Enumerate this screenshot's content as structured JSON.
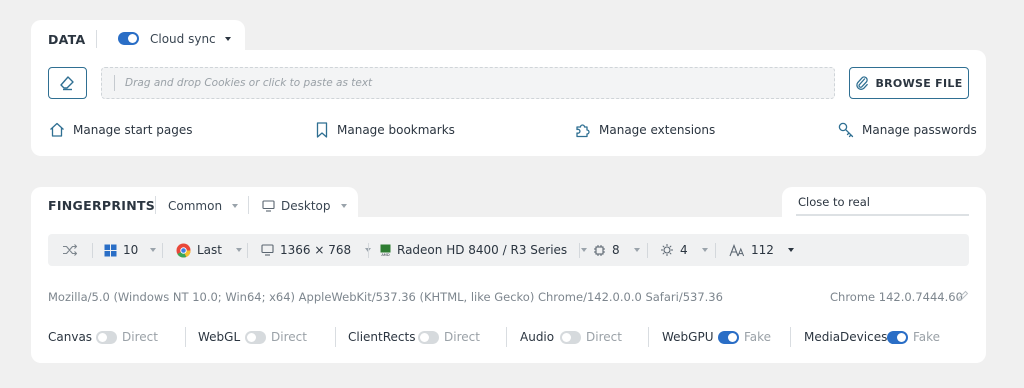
{
  "data_section": {
    "title": "DATA",
    "cloud_sync": {
      "label": "Cloud sync",
      "enabled": true
    },
    "cookies_placeholder": "Drag and drop Cookies or click to paste as text",
    "browse_label": "BROWSE FILE",
    "links": [
      {
        "label": "Manage start pages",
        "icon": "home-icon"
      },
      {
        "label": "Manage bookmarks",
        "icon": "bookmark-icon"
      },
      {
        "label": "Manage extensions",
        "icon": "puzzle-icon"
      },
      {
        "label": "Manage passwords",
        "icon": "key-icon"
      }
    ]
  },
  "fingerprints": {
    "title": "FINGERPRINTS",
    "preset": "Common",
    "device": "Desktop",
    "close_to_real": "Close to real",
    "params": {
      "os": "10",
      "browser": "Last",
      "resolution": "1366 × 768",
      "gpu": "Radeon HD 8400 / R3 Series",
      "cpu": "8",
      "memory": "4",
      "fonts": "112"
    },
    "user_agent": "Mozilla/5.0 (Windows NT 10.0; Win64; x64) AppleWebKit/537.36 (KHTML, like Gecko) Chrome/142.0.0.0 Safari/537.36",
    "chrome_version": "Chrome 142.0.7444.60",
    "protections": [
      {
        "name": "Canvas",
        "mode": "Direct",
        "enabled": false
      },
      {
        "name": "WebGL",
        "mode": "Direct",
        "enabled": false
      },
      {
        "name": "ClientRects",
        "mode": "Direct",
        "enabled": false
      },
      {
        "name": "Audio",
        "mode": "Direct",
        "enabled": false
      },
      {
        "name": "WebGPU",
        "mode": "Fake",
        "enabled": true
      },
      {
        "name": "MediaDevices",
        "mode": "Fake",
        "enabled": true
      }
    ]
  },
  "colors": {
    "accent": "#2a6ec6",
    "border_accent": "#2f6f92",
    "background": "#f0f0f0"
  }
}
